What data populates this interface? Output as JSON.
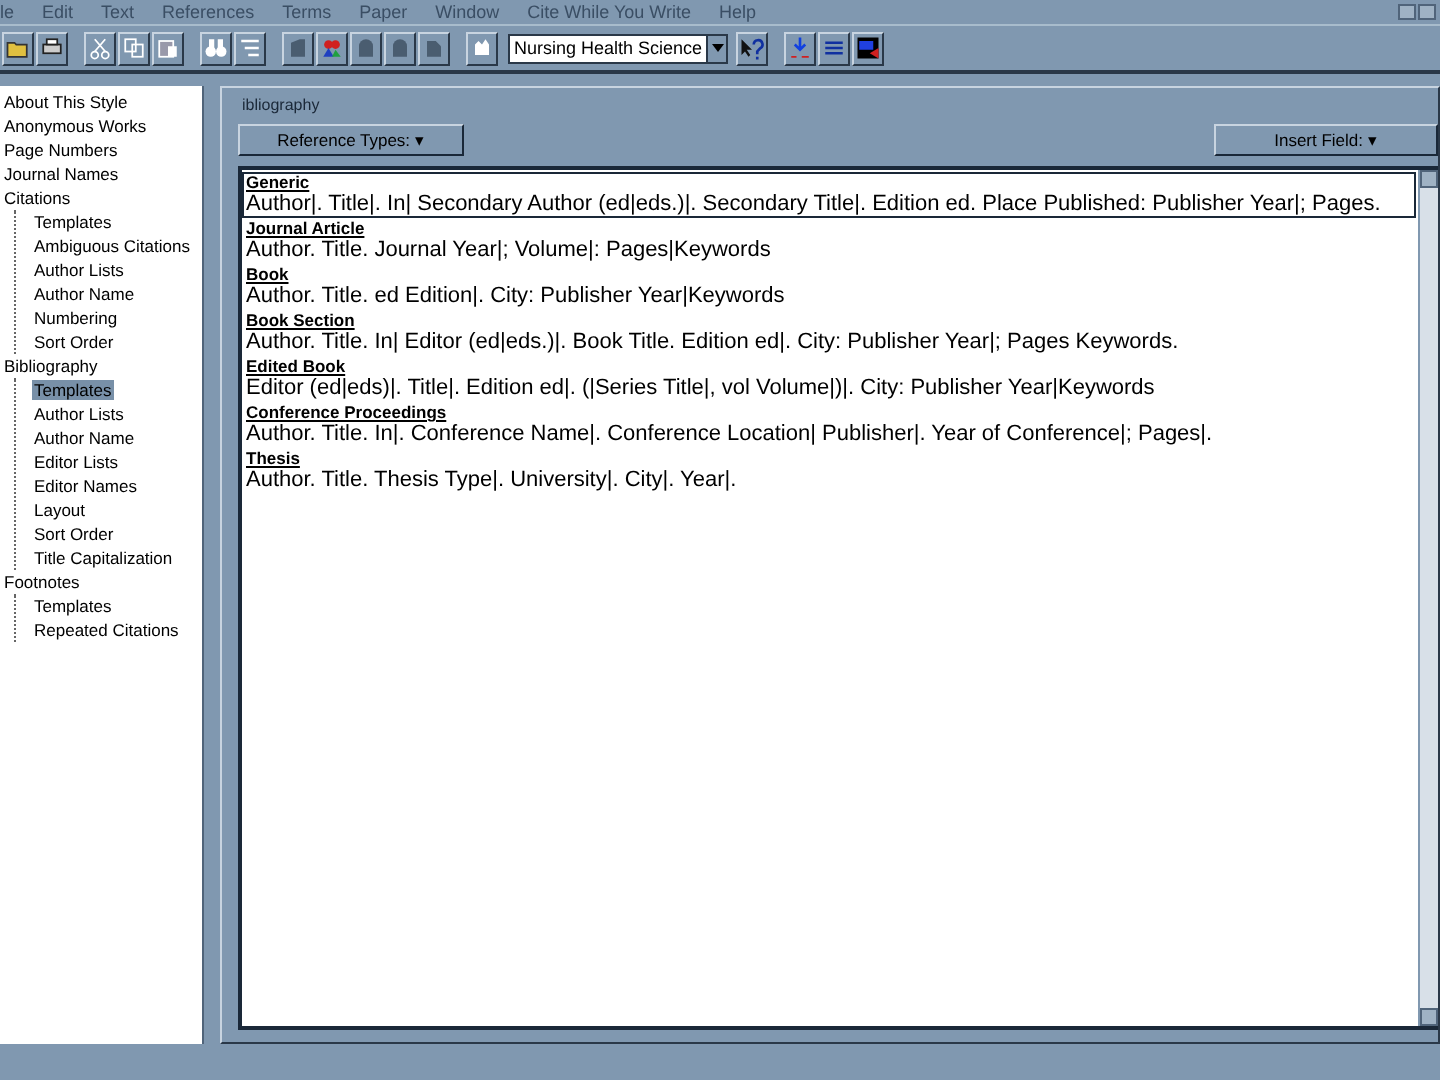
{
  "menu_bar": [
    "le",
    "Edit",
    "Text",
    "References",
    "Terms",
    "Paper",
    "Window",
    "Cite While You Write",
    "Help"
  ],
  "toolbar": {
    "library_dropdown": {
      "value": "Nursing Health Science"
    }
  },
  "style_tree": [
    {
      "label": "About This Style",
      "selected": false
    },
    {
      "label": "Anonymous Works",
      "selected": false
    },
    {
      "label": "Page Numbers",
      "selected": false
    },
    {
      "label": "Journal Names",
      "selected": false
    },
    {
      "label": "Citations",
      "selected": false,
      "children": [
        {
          "label": "Templates",
          "selected": false
        },
        {
          "label": "Ambiguous Citations",
          "selected": false
        },
        {
          "label": "Author Lists",
          "selected": false
        },
        {
          "label": "Author Name",
          "selected": false
        },
        {
          "label": "Numbering",
          "selected": false
        },
        {
          "label": "Sort Order",
          "selected": false
        }
      ]
    },
    {
      "label": "Bibliography",
      "selected": false,
      "children": [
        {
          "label": "Templates",
          "selected": true
        },
        {
          "label": "Author Lists",
          "selected": false
        },
        {
          "label": "Author Name",
          "selected": false
        },
        {
          "label": "Editor Lists",
          "selected": false
        },
        {
          "label": "Editor Names",
          "selected": false
        },
        {
          "label": "Layout",
          "selected": false
        },
        {
          "label": "Sort Order",
          "selected": false
        },
        {
          "label": "Title Capitalization",
          "selected": false
        }
      ]
    },
    {
      "label": "Footnotes",
      "selected": false,
      "children": [
        {
          "label": "Templates",
          "selected": false
        },
        {
          "label": "Repeated Citations",
          "selected": false
        }
      ]
    }
  ],
  "panel": {
    "group_title": "ibliography",
    "reference_types_button": "Reference Types: ▾",
    "insert_field_button": "Insert Field: ▾",
    "templates": [
      {
        "type": "Generic",
        "template": "Author|. Title|. In| Secondary Author (ed|eds.)|. Secondary Title|. Edition ed. Place Published: Publisher Year|; Pages.",
        "selected": true
      },
      {
        "type": "Journal Article",
        "template": "Author. Title. Journal Year|; Volume|: Pages|Keywords",
        "selected": false
      },
      {
        "type": "Book",
        "template": "Author. Title. ed Edition|. City: Publisher Year|Keywords",
        "selected": false
      },
      {
        "type": "Book Section",
        "template": "Author. Title. In| Editor (ed|eds.)|. Book Title. Edition ed|. City: Publisher Year|; Pages Keywords.",
        "selected": false
      },
      {
        "type": "Edited Book",
        "template": "Editor (ed|eds)|. Title|. Edition ed|. (|Series Title|, vol Volume|)|. City: Publisher Year|Keywords",
        "selected": false
      },
      {
        "type": "Conference Proceedings",
        "template": "Author. Title. In|. Conference Name|. Conference Location| Publisher|. Year of Conference|; Pages|.",
        "selected": false
      },
      {
        "type": "Thesis",
        "template": "Author. Title. Thesis Type|. University|. City|. Year|.",
        "selected": false
      }
    ]
  }
}
